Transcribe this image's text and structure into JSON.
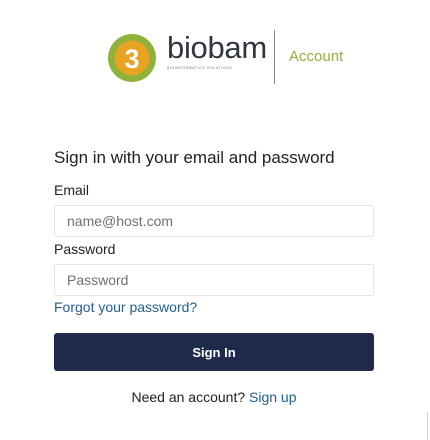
{
  "brand": {
    "name": "biobam",
    "tagline": "BIOINFORMATICS SOLUTIONS",
    "account_label": "Account",
    "colors": {
      "logo_green": "#8fb23a",
      "logo_orange": "#e8a321",
      "brand_text": "#303640"
    }
  },
  "form": {
    "title": "Sign in with your email and password",
    "email": {
      "label": "Email",
      "placeholder": "name@host.com",
      "value": ""
    },
    "password": {
      "label": "Password",
      "placeholder": "Password",
      "value": ""
    },
    "forgot_password": "Forgot your password?",
    "submit_label": "Sign In",
    "signup_prompt": "Need an account?",
    "signup_link": "Sign up",
    "colors": {
      "button": "#1d2a4c",
      "link": "#1f5f8e"
    }
  }
}
